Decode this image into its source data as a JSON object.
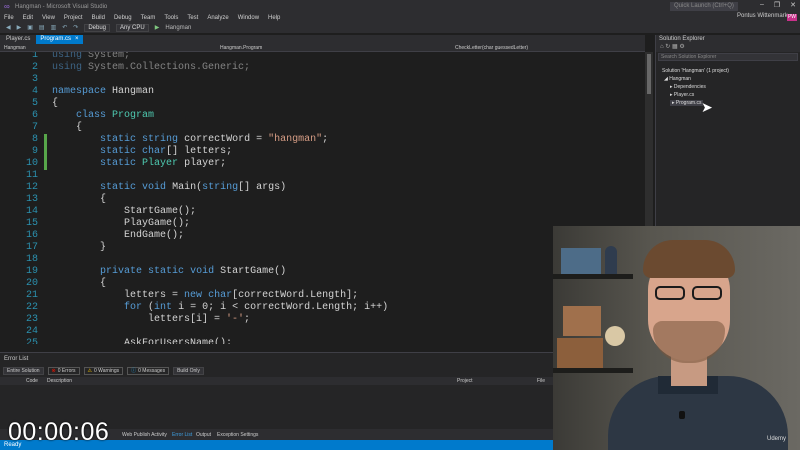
{
  "window": {
    "title": "Hangman - Microsoft Visual Studio",
    "quick_launch_placeholder": "Quick Launch (Ctrl+Q)",
    "min": "–",
    "max": "❐",
    "close": "✕"
  },
  "menu": [
    "File",
    "Edit",
    "View",
    "Project",
    "Build",
    "Debug",
    "Team",
    "Tools",
    "Test",
    "Analyze",
    "Window",
    "Help"
  ],
  "user": {
    "name": "Pontus Wittenmark",
    "initials": "PW"
  },
  "toolbar": {
    "config": "Debug",
    "platform": "Any CPU",
    "run_target": "Hangman"
  },
  "tabs": [
    {
      "label": "Player.cs"
    },
    {
      "label": "Program.cs",
      "active": true
    }
  ],
  "navbar": {
    "project": "Hangman",
    "class": "Hangman.Program",
    "member": "CheckLetter(char guessedLetter)"
  },
  "code": [
    {
      "n": "1",
      "t": "using System;"
    },
    {
      "n": "2",
      "t": "using System.Collections.Generic;"
    },
    {
      "n": "3",
      "t": ""
    },
    {
      "n": "4",
      "t": "namespace Hangman"
    },
    {
      "n": "5",
      "t": "{"
    },
    {
      "n": "6",
      "t": "    class Program"
    },
    {
      "n": "7",
      "t": "    {"
    },
    {
      "n": "8",
      "t": "        static string correctWord = \"hangman\";"
    },
    {
      "n": "9",
      "t": "        static char[] letters;"
    },
    {
      "n": "10",
      "t": "        static Player player;"
    },
    {
      "n": "11",
      "t": ""
    },
    {
      "n": "12",
      "t": "        static void Main(string[] args)"
    },
    {
      "n": "13",
      "t": "        {"
    },
    {
      "n": "14",
      "t": "            StartGame();"
    },
    {
      "n": "15",
      "t": "            PlayGame();"
    },
    {
      "n": "16",
      "t": "            EndGame();"
    },
    {
      "n": "17",
      "t": "        }"
    },
    {
      "n": "18",
      "t": ""
    },
    {
      "n": "19",
      "t": "        private static void StartGame()"
    },
    {
      "n": "20",
      "t": "        {"
    },
    {
      "n": "21",
      "t": "            letters = new char[correctWord.Length];"
    },
    {
      "n": "22",
      "t": "            for (int i = 0; i < correctWord.Length; i++)"
    },
    {
      "n": "23",
      "t": "                letters[i] = '-';"
    },
    {
      "n": "24",
      "t": ""
    },
    {
      "n": "25",
      "t": "            AskForUsersName();"
    }
  ],
  "solution_explorer": {
    "title": "Solution Explorer",
    "search_placeholder": "Search Solution Explorer",
    "solution": "Solution 'Hangman' (1 project)",
    "project": "Hangman",
    "items": [
      "Dependencies",
      "Player.cs",
      "Program.cs"
    ]
  },
  "error_list": {
    "title": "Error List",
    "scope": "Entire Solution",
    "errors": "0 Errors",
    "warnings": "0 Warnings",
    "messages": "0 Messages",
    "filter": "Build Only",
    "columns": [
      "Code",
      "Description",
      "Project",
      "File"
    ]
  },
  "bottom_tabs": [
    {
      "label": "Web Publish Activity"
    },
    {
      "label": "Error List",
      "active": true
    },
    {
      "label": "Output"
    },
    {
      "label": "Exception Settings"
    }
  ],
  "status": {
    "text": "Ready"
  },
  "overlay": {
    "timer": "00:00:06",
    "watermark": "Udemy"
  },
  "colors": {
    "accent": "#007acc",
    "keyword": "#569cd6",
    "type": "#4ec9b0",
    "string": "#d69d85",
    "line_number": "#2b91af"
  }
}
